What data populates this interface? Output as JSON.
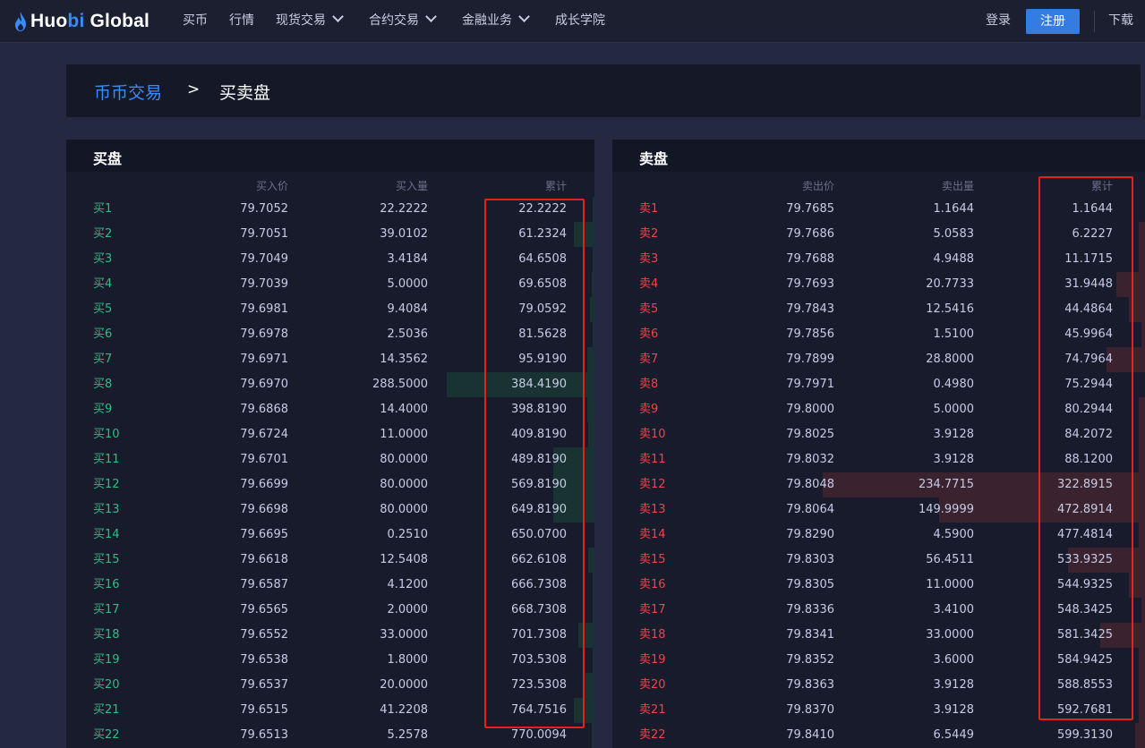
{
  "nav": {
    "logo_prefix": "Huo",
    "logo_mid": "bi",
    "logo_suffix": " Global",
    "items": [
      {
        "label": "买币"
      },
      {
        "label": "行情"
      },
      {
        "label": "现货交易"
      },
      {
        "label": "合约交易"
      },
      {
        "label": "金融业务"
      },
      {
        "label": "成长学院"
      }
    ],
    "login": "登录",
    "register": "注册",
    "download": "下载"
  },
  "breadcrumb": {
    "link": "币币交易",
    "separator": ">",
    "current": "买卖盘"
  },
  "colors": {
    "bid_green": "#2ebd85",
    "ask_red": "#f0434a",
    "accent_blue": "#357ce1",
    "highlight": "#e3211e"
  },
  "bids": {
    "title": "买盘",
    "headers": {
      "price": "买入价",
      "amount": "买入量",
      "total": "累计"
    },
    "rows": [
      {
        "label": "买1",
        "price": "79.7052",
        "amount": "22.2222",
        "total": "22.2222",
        "depth": 0.01
      },
      {
        "label": "买2",
        "price": "79.7051",
        "amount": "39.0102",
        "total": "61.2324",
        "depth": 0.14
      },
      {
        "label": "买3",
        "price": "79.7049",
        "amount": "3.4184",
        "total": "64.6508",
        "depth": 0.01
      },
      {
        "label": "买4",
        "price": "79.7039",
        "amount": "5.0000",
        "total": "69.6508",
        "depth": 0.02
      },
      {
        "label": "买5",
        "price": "79.6981",
        "amount": "9.4084",
        "total": "79.0592",
        "depth": 0.03
      },
      {
        "label": "买6",
        "price": "79.6978",
        "amount": "2.5036",
        "total": "81.5628",
        "depth": 0.01
      },
      {
        "label": "买7",
        "price": "79.6971",
        "amount": "14.3562",
        "total": "95.9190",
        "depth": 0.05
      },
      {
        "label": "买8",
        "price": "79.6970",
        "amount": "288.5000",
        "total": "384.4190",
        "depth": 1.0
      },
      {
        "label": "买9",
        "price": "79.6868",
        "amount": "14.4000",
        "total": "398.8190",
        "depth": 0.05
      },
      {
        "label": "买10",
        "price": "79.6724",
        "amount": "11.0000",
        "total": "409.8190",
        "depth": 0.04
      },
      {
        "label": "买11",
        "price": "79.6701",
        "amount": "80.0000",
        "total": "489.8190",
        "depth": 0.28
      },
      {
        "label": "买12",
        "price": "79.6699",
        "amount": "80.0000",
        "total": "569.8190",
        "depth": 0.28
      },
      {
        "label": "买13",
        "price": "79.6698",
        "amount": "80.0000",
        "total": "649.8190",
        "depth": 0.28
      },
      {
        "label": "买14",
        "price": "79.6695",
        "amount": "0.2510",
        "total": "650.0700",
        "depth": 0.0
      },
      {
        "label": "买15",
        "price": "79.6618",
        "amount": "12.5408",
        "total": "662.6108",
        "depth": 0.04
      },
      {
        "label": "买16",
        "price": "79.6587",
        "amount": "4.1200",
        "total": "666.7308",
        "depth": 0.01
      },
      {
        "label": "买17",
        "price": "79.6565",
        "amount": "2.0000",
        "total": "668.7308",
        "depth": 0.01
      },
      {
        "label": "买18",
        "price": "79.6552",
        "amount": "33.0000",
        "total": "701.7308",
        "depth": 0.11
      },
      {
        "label": "买19",
        "price": "79.6538",
        "amount": "1.8000",
        "total": "703.5308",
        "depth": 0.01
      },
      {
        "label": "买20",
        "price": "79.6537",
        "amount": "20.0000",
        "total": "723.5308",
        "depth": 0.07
      },
      {
        "label": "买21",
        "price": "79.6515",
        "amount": "41.2208",
        "total": "764.7516",
        "depth": 0.14
      },
      {
        "label": "买22",
        "price": "79.6513",
        "amount": "5.2578",
        "total": "770.0094",
        "depth": 0.02
      }
    ]
  },
  "asks": {
    "title": "卖盘",
    "headers": {
      "price": "卖出价",
      "amount": "卖出量",
      "total": "累计"
    },
    "rows": [
      {
        "label": "卖1",
        "price": "79.7685",
        "amount": "1.1644",
        "total": "1.1644",
        "depth": 0.0
      },
      {
        "label": "卖2",
        "price": "79.7686",
        "amount": "5.0583",
        "total": "6.2227",
        "depth": 0.02
      },
      {
        "label": "卖3",
        "price": "79.7688",
        "amount": "4.9488",
        "total": "11.1715",
        "depth": 0.02
      },
      {
        "label": "卖4",
        "price": "79.7693",
        "amount": "20.7733",
        "total": "31.9448",
        "depth": 0.09
      },
      {
        "label": "卖5",
        "price": "79.7843",
        "amount": "12.5416",
        "total": "44.4864",
        "depth": 0.05
      },
      {
        "label": "卖6",
        "price": "79.7856",
        "amount": "1.5100",
        "total": "45.9964",
        "depth": 0.01
      },
      {
        "label": "卖7",
        "price": "79.7899",
        "amount": "28.8000",
        "total": "74.7964",
        "depth": 0.12
      },
      {
        "label": "卖8",
        "price": "79.7971",
        "amount": "0.4980",
        "total": "75.2944",
        "depth": 0.0
      },
      {
        "label": "卖9",
        "price": "79.8000",
        "amount": "5.0000",
        "total": "80.2944",
        "depth": 0.02
      },
      {
        "label": "卖10",
        "price": "79.8025",
        "amount": "3.9128",
        "total": "84.2072",
        "depth": 0.02
      },
      {
        "label": "卖11",
        "price": "79.8032",
        "amount": "3.9128",
        "total": "88.1200",
        "depth": 0.02
      },
      {
        "label": "卖12",
        "price": "79.8048",
        "amount": "234.7715",
        "total": "322.8915",
        "depth": 1.0
      },
      {
        "label": "卖13",
        "price": "79.8064",
        "amount": "149.9999",
        "total": "472.8914",
        "depth": 0.64
      },
      {
        "label": "卖14",
        "price": "79.8290",
        "amount": "4.5900",
        "total": "477.4814",
        "depth": 0.02
      },
      {
        "label": "卖15",
        "price": "79.8303",
        "amount": "56.4511",
        "total": "533.9325",
        "depth": 0.24
      },
      {
        "label": "卖16",
        "price": "79.8305",
        "amount": "11.0000",
        "total": "544.9325",
        "depth": 0.05
      },
      {
        "label": "卖17",
        "price": "79.8336",
        "amount": "3.4100",
        "total": "548.3425",
        "depth": 0.01
      },
      {
        "label": "卖18",
        "price": "79.8341",
        "amount": "33.0000",
        "total": "581.3425",
        "depth": 0.14
      },
      {
        "label": "卖19",
        "price": "79.8352",
        "amount": "3.6000",
        "total": "584.9425",
        "depth": 0.02
      },
      {
        "label": "卖20",
        "price": "79.8363",
        "amount": "3.9128",
        "total": "588.8553",
        "depth": 0.02
      },
      {
        "label": "卖21",
        "price": "79.8370",
        "amount": "3.9128",
        "total": "592.7681",
        "depth": 0.02
      },
      {
        "label": "卖22",
        "price": "79.8410",
        "amount": "6.5449",
        "total": "599.3130",
        "depth": 0.03
      }
    ]
  }
}
